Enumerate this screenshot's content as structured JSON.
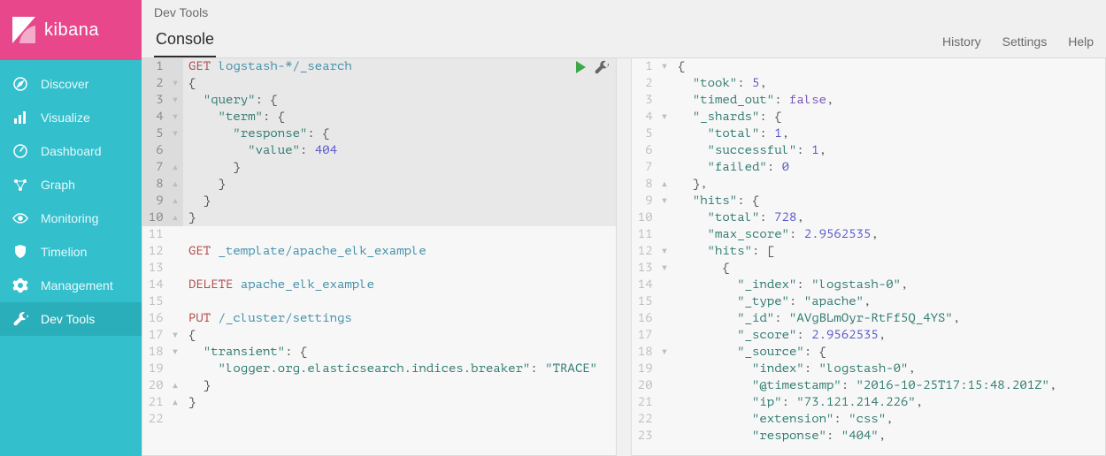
{
  "brand": {
    "name": "kibana"
  },
  "sidebar": {
    "items": [
      {
        "label": "Discover",
        "icon": "compass-icon"
      },
      {
        "label": "Visualize",
        "icon": "bar-chart-icon"
      },
      {
        "label": "Dashboard",
        "icon": "gauge-icon"
      },
      {
        "label": "Graph",
        "icon": "graph-icon"
      },
      {
        "label": "Monitoring",
        "icon": "eye-icon"
      },
      {
        "label": "Timelion",
        "icon": "shield-icon"
      },
      {
        "label": "Management",
        "icon": "gear-icon"
      },
      {
        "label": "Dev Tools",
        "icon": "wrench-icon"
      }
    ],
    "active_index": 7
  },
  "header": {
    "breadcrumb": "Dev Tools",
    "tab": "Console",
    "links": {
      "history": "History",
      "settings": "Settings",
      "help": "Help"
    }
  },
  "editor": {
    "lines": [
      {
        "n": 1,
        "hl": true,
        "fold": "",
        "tokens": [
          [
            "GET",
            "method-get"
          ],
          [
            " ",
            "punc"
          ],
          [
            "logstash-*/_search",
            "path"
          ]
        ]
      },
      {
        "n": 2,
        "hl": true,
        "fold": "▾",
        "tokens": [
          [
            "{",
            "punc"
          ]
        ]
      },
      {
        "n": 3,
        "hl": true,
        "fold": "▾",
        "tokens": [
          [
            "  ",
            "punc"
          ],
          [
            "\"query\"",
            "key"
          ],
          [
            ": {",
            "punc"
          ]
        ]
      },
      {
        "n": 4,
        "hl": true,
        "fold": "▾",
        "tokens": [
          [
            "    ",
            "punc"
          ],
          [
            "\"term\"",
            "key"
          ],
          [
            ": {",
            "punc"
          ]
        ]
      },
      {
        "n": 5,
        "hl": true,
        "fold": "▾",
        "tokens": [
          [
            "      ",
            "punc"
          ],
          [
            "\"response\"",
            "key"
          ],
          [
            ": {",
            "punc"
          ]
        ]
      },
      {
        "n": 6,
        "hl": true,
        "fold": "",
        "tokens": [
          [
            "        ",
            "punc"
          ],
          [
            "\"value\"",
            "key"
          ],
          [
            ": ",
            "punc"
          ],
          [
            "404",
            "num"
          ]
        ]
      },
      {
        "n": 7,
        "hl": true,
        "fold": "▴",
        "tokens": [
          [
            "      }",
            "punc"
          ]
        ]
      },
      {
        "n": 8,
        "hl": true,
        "fold": "▴",
        "tokens": [
          [
            "    }",
            "punc"
          ]
        ]
      },
      {
        "n": 9,
        "hl": true,
        "fold": "▴",
        "tokens": [
          [
            "  }",
            "punc"
          ]
        ]
      },
      {
        "n": 10,
        "hl": true,
        "fold": "▴",
        "tokens": [
          [
            "}",
            "punc"
          ]
        ]
      },
      {
        "n": 11,
        "hl": false,
        "fold": "",
        "tokens": [
          [
            "",
            "punc"
          ]
        ]
      },
      {
        "n": 12,
        "hl": false,
        "fold": "",
        "tokens": [
          [
            "GET",
            "method-get"
          ],
          [
            " ",
            "punc"
          ],
          [
            "_template/apache_elk_example",
            "path"
          ]
        ]
      },
      {
        "n": 13,
        "hl": false,
        "fold": "",
        "tokens": [
          [
            "",
            "punc"
          ]
        ]
      },
      {
        "n": 14,
        "hl": false,
        "fold": "",
        "tokens": [
          [
            "DELETE",
            "method-delete"
          ],
          [
            " ",
            "punc"
          ],
          [
            "apache_elk_example",
            "path"
          ]
        ]
      },
      {
        "n": 15,
        "hl": false,
        "fold": "",
        "tokens": [
          [
            "",
            "punc"
          ]
        ]
      },
      {
        "n": 16,
        "hl": false,
        "fold": "",
        "tokens": [
          [
            "PUT",
            "method-put"
          ],
          [
            " ",
            "punc"
          ],
          [
            "/_cluster/settings",
            "path"
          ]
        ]
      },
      {
        "n": 17,
        "hl": false,
        "fold": "▾",
        "tokens": [
          [
            "{",
            "punc"
          ]
        ]
      },
      {
        "n": 18,
        "hl": false,
        "fold": "▾",
        "tokens": [
          [
            "  ",
            "punc"
          ],
          [
            "\"transient\"",
            "key"
          ],
          [
            ": {",
            "punc"
          ]
        ]
      },
      {
        "n": 19,
        "hl": false,
        "fold": "",
        "tokens": [
          [
            "    ",
            "punc"
          ],
          [
            "\"logger.org.elasticsearch.indices.breaker\"",
            "key"
          ],
          [
            ": ",
            "punc"
          ],
          [
            "\"TRACE\"",
            "str"
          ]
        ]
      },
      {
        "n": 20,
        "hl": false,
        "fold": "▴",
        "tokens": [
          [
            "  }",
            "punc"
          ]
        ]
      },
      {
        "n": 21,
        "hl": false,
        "fold": "▴",
        "tokens": [
          [
            "}",
            "punc"
          ]
        ]
      },
      {
        "n": 22,
        "hl": false,
        "fold": "",
        "tokens": [
          [
            "",
            "punc"
          ]
        ]
      }
    ]
  },
  "response": {
    "lines": [
      {
        "n": 1,
        "fold": "▾",
        "tokens": [
          [
            "{",
            "punc"
          ]
        ]
      },
      {
        "n": 2,
        "fold": "",
        "tokens": [
          [
            "  ",
            "punc"
          ],
          [
            "\"took\"",
            "key"
          ],
          [
            ": ",
            "punc"
          ],
          [
            "5",
            "num"
          ],
          [
            ",",
            "punc"
          ]
        ]
      },
      {
        "n": 3,
        "fold": "",
        "tokens": [
          [
            "  ",
            "punc"
          ],
          [
            "\"timed_out\"",
            "key"
          ],
          [
            ": ",
            "punc"
          ],
          [
            "false",
            "bool"
          ],
          [
            ",",
            "punc"
          ]
        ]
      },
      {
        "n": 4,
        "fold": "▾",
        "tokens": [
          [
            "  ",
            "punc"
          ],
          [
            "\"_shards\"",
            "key"
          ],
          [
            ": {",
            "punc"
          ]
        ]
      },
      {
        "n": 5,
        "fold": "",
        "tokens": [
          [
            "    ",
            "punc"
          ],
          [
            "\"total\"",
            "key"
          ],
          [
            ": ",
            "punc"
          ],
          [
            "1",
            "num"
          ],
          [
            ",",
            "punc"
          ]
        ]
      },
      {
        "n": 6,
        "fold": "",
        "tokens": [
          [
            "    ",
            "punc"
          ],
          [
            "\"successful\"",
            "key"
          ],
          [
            ": ",
            "punc"
          ],
          [
            "1",
            "num"
          ],
          [
            ",",
            "punc"
          ]
        ]
      },
      {
        "n": 7,
        "fold": "",
        "tokens": [
          [
            "    ",
            "punc"
          ],
          [
            "\"failed\"",
            "key"
          ],
          [
            ": ",
            "punc"
          ],
          [
            "0",
            "num"
          ]
        ]
      },
      {
        "n": 8,
        "fold": "▴",
        "tokens": [
          [
            "  },",
            "punc"
          ]
        ]
      },
      {
        "n": 9,
        "fold": "▾",
        "tokens": [
          [
            "  ",
            "punc"
          ],
          [
            "\"hits\"",
            "key"
          ],
          [
            ": {",
            "punc"
          ]
        ]
      },
      {
        "n": 10,
        "fold": "",
        "tokens": [
          [
            "    ",
            "punc"
          ],
          [
            "\"total\"",
            "key"
          ],
          [
            ": ",
            "punc"
          ],
          [
            "728",
            "num"
          ],
          [
            ",",
            "punc"
          ]
        ]
      },
      {
        "n": 11,
        "fold": "",
        "tokens": [
          [
            "    ",
            "punc"
          ],
          [
            "\"max_score\"",
            "key"
          ],
          [
            ": ",
            "punc"
          ],
          [
            "2.9562535",
            "num"
          ],
          [
            ",",
            "punc"
          ]
        ]
      },
      {
        "n": 12,
        "fold": "▾",
        "tokens": [
          [
            "    ",
            "punc"
          ],
          [
            "\"hits\"",
            "key"
          ],
          [
            ": [",
            "punc"
          ]
        ]
      },
      {
        "n": 13,
        "fold": "▾",
        "tokens": [
          [
            "      {",
            "punc"
          ]
        ]
      },
      {
        "n": 14,
        "fold": "",
        "tokens": [
          [
            "        ",
            "punc"
          ],
          [
            "\"_index\"",
            "key"
          ],
          [
            ": ",
            "punc"
          ],
          [
            "\"logstash-0\"",
            "str"
          ],
          [
            ",",
            "punc"
          ]
        ]
      },
      {
        "n": 15,
        "fold": "",
        "tokens": [
          [
            "        ",
            "punc"
          ],
          [
            "\"_type\"",
            "key"
          ],
          [
            ": ",
            "punc"
          ],
          [
            "\"apache\"",
            "str"
          ],
          [
            ",",
            "punc"
          ]
        ]
      },
      {
        "n": 16,
        "fold": "",
        "tokens": [
          [
            "        ",
            "punc"
          ],
          [
            "\"_id\"",
            "key"
          ],
          [
            ": ",
            "punc"
          ],
          [
            "\"AVgBLmOyr-RtFf5Q_4YS\"",
            "str"
          ],
          [
            ",",
            "punc"
          ]
        ]
      },
      {
        "n": 17,
        "fold": "",
        "tokens": [
          [
            "        ",
            "punc"
          ],
          [
            "\"_score\"",
            "key"
          ],
          [
            ": ",
            "punc"
          ],
          [
            "2.9562535",
            "num"
          ],
          [
            ",",
            "punc"
          ]
        ]
      },
      {
        "n": 18,
        "fold": "▾",
        "tokens": [
          [
            "        ",
            "punc"
          ],
          [
            "\"_source\"",
            "key"
          ],
          [
            ": {",
            "punc"
          ]
        ]
      },
      {
        "n": 19,
        "fold": "",
        "tokens": [
          [
            "          ",
            "punc"
          ],
          [
            "\"index\"",
            "key"
          ],
          [
            ": ",
            "punc"
          ],
          [
            "\"logstash-0\"",
            "str"
          ],
          [
            ",",
            "punc"
          ]
        ]
      },
      {
        "n": 20,
        "fold": "",
        "tokens": [
          [
            "          ",
            "punc"
          ],
          [
            "\"@timestamp\"",
            "key"
          ],
          [
            ": ",
            "punc"
          ],
          [
            "\"2016-10-25T17:15:48.201Z\"",
            "str"
          ],
          [
            ",",
            "punc"
          ]
        ]
      },
      {
        "n": 21,
        "fold": "",
        "tokens": [
          [
            "          ",
            "punc"
          ],
          [
            "\"ip\"",
            "key"
          ],
          [
            ": ",
            "punc"
          ],
          [
            "\"73.121.214.226\"",
            "str"
          ],
          [
            ",",
            "punc"
          ]
        ]
      },
      {
        "n": 22,
        "fold": "",
        "tokens": [
          [
            "          ",
            "punc"
          ],
          [
            "\"extension\"",
            "key"
          ],
          [
            ": ",
            "punc"
          ],
          [
            "\"css\"",
            "str"
          ],
          [
            ",",
            "punc"
          ]
        ]
      },
      {
        "n": 23,
        "fold": "",
        "tokens": [
          [
            "          ",
            "punc"
          ],
          [
            "\"response\"",
            "key"
          ],
          [
            ": ",
            "punc"
          ],
          [
            "\"404\"",
            "str"
          ],
          [
            ",",
            "punc"
          ]
        ]
      }
    ]
  }
}
